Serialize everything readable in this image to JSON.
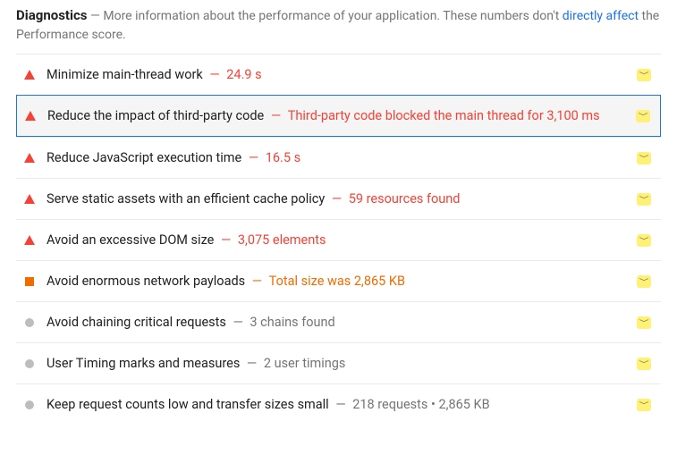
{
  "header": {
    "title": "Diagnostics",
    "desc_prefix": " — More information about the performance of your application. These numbers don't ",
    "link": "directly affect",
    "desc_suffix": " the Performance score."
  },
  "rows": [
    {
      "icon": "tri-red",
      "label": "Minimize main-thread work",
      "sep": "—",
      "value": "24.9 s",
      "tone": "red",
      "selected": false
    },
    {
      "icon": "tri-red",
      "label": "Reduce the impact of third-party code",
      "sep": "—",
      "value": "Third-party code blocked the main thread for 3,100 ms",
      "tone": "red",
      "selected": true
    },
    {
      "icon": "tri-red",
      "label": "Reduce JavaScript execution time",
      "sep": "—",
      "value": "16.5 s",
      "tone": "red",
      "selected": false
    },
    {
      "icon": "tri-red",
      "label": "Serve static assets with an efficient cache policy",
      "sep": "—",
      "value": "59 resources found",
      "tone": "red",
      "selected": false
    },
    {
      "icon": "tri-red",
      "label": "Avoid an excessive DOM size",
      "sep": "—",
      "value": "3,075 elements",
      "tone": "red",
      "selected": false
    },
    {
      "icon": "sq-orange",
      "label": "Avoid enormous network payloads",
      "sep": "—",
      "value": "Total size was 2,865 KB",
      "tone": "orange",
      "selected": false
    },
    {
      "icon": "dot-grey",
      "label": "Avoid chaining critical requests",
      "sep": "—",
      "value": "3 chains found",
      "tone": "grey",
      "selected": false
    },
    {
      "icon": "dot-grey",
      "label": "User Timing marks and measures",
      "sep": "—",
      "value": "2 user timings",
      "tone": "grey",
      "selected": false
    },
    {
      "icon": "dot-grey",
      "label": "Keep request counts low and transfer sizes small",
      "sep": "—",
      "value": "218 requests • 2,865 KB",
      "tone": "grey",
      "selected": false
    }
  ]
}
